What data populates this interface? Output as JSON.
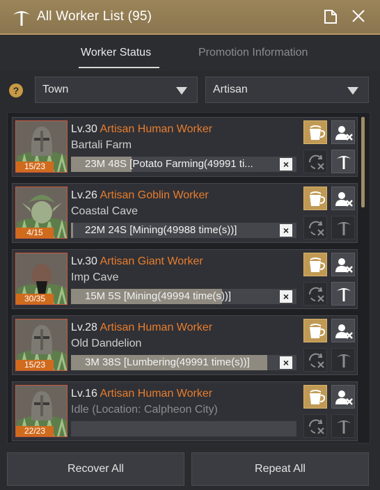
{
  "window": {
    "title": "All Worker List (95)",
    "icons": {
      "title": "pickaxe-icon",
      "memo": "memo-icon",
      "close": "close-icon"
    },
    "accent_color": "#9b8458"
  },
  "tabs": [
    {
      "label": "Worker Status",
      "active": true
    },
    {
      "label": "Promotion Information",
      "active": false
    }
  ],
  "filters": {
    "help_icon": "question-icon",
    "town": {
      "selected": "Town"
    },
    "worker_type": {
      "selected": "Artisan"
    }
  },
  "workers": [
    {
      "level": "Lv.30",
      "name": "Artisan Human Worker",
      "location": "Bartali Farm",
      "stamina": "15/23",
      "task": "23M 48S [Potato Farming(49991 ti...",
      "progress": 0.27,
      "race": "human",
      "idle": false,
      "can_promote": true
    },
    {
      "level": "Lv.26",
      "name": "Artisan Goblin Worker",
      "location": "Coastal Cave",
      "stamina": "4/15",
      "task": "22M 24S [Mining(49988 time(s))]",
      "progress": 0.01,
      "race": "goblin",
      "idle": false,
      "can_promote": false
    },
    {
      "level": "Lv.30",
      "name": "Artisan Giant Worker",
      "location": "Imp Cave",
      "stamina": "30/35",
      "task": "15M 5S [Mining(49994 time(s))]",
      "progress": 0.67,
      "race": "giant",
      "idle": false,
      "can_promote": true
    },
    {
      "level": "Lv.28",
      "name": "Artisan Human Worker",
      "location": "Old Dandelion",
      "stamina": "15/23",
      "task": "3M 38S [Lumbering(49991 time(s))]",
      "progress": 0.87,
      "race": "human",
      "idle": false,
      "can_promote": false
    },
    {
      "level": "Lv.16",
      "name": "Artisan Human Worker",
      "location": "Idle (Location: Calpheon City)",
      "stamina": "22/23",
      "task": "",
      "progress": 0,
      "race": "human",
      "idle": true,
      "can_promote": false
    }
  ],
  "actions": {
    "recover_all": "Recover All",
    "repeat_all": "Repeat All"
  }
}
